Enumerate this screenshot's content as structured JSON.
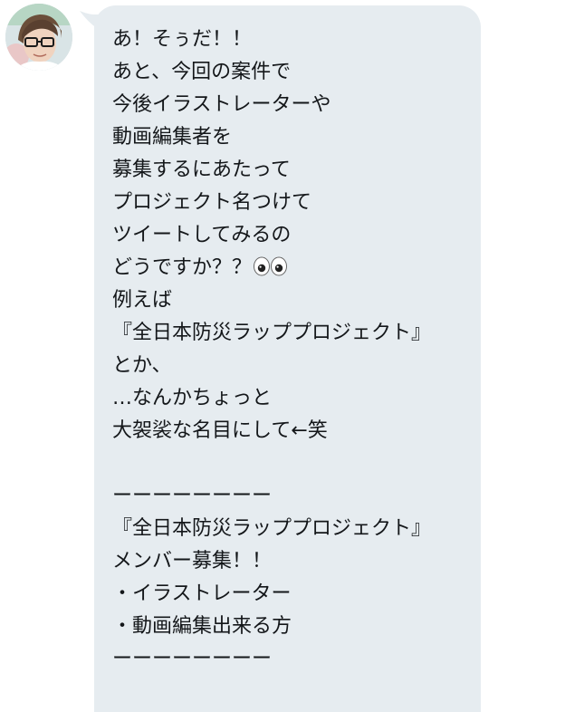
{
  "conversation": {
    "message": {
      "lines": [
        "あ！そぅだ！！",
        "あと、今回の案件で",
        "今後イラストレーターや",
        "動画編集者を",
        "募集するにあたって",
        "プロジェクト名つけて",
        "ツイートしてみるの",
        "どうですか？？",
        "例えば",
        "『全日本防災ラッププロジェクト』",
        "とか、",
        "…なんかちょっと",
        "大袈裟な名目にして←笑",
        "",
        "ーーーーーーーー",
        "『全日本防災ラッププロジェクト』",
        "メンバー募集！！",
        "・イラストレーター",
        "・動画編集出来る方",
        "ーーーーーーーー"
      ],
      "emoji_after_line_8": "eyes-icon"
    }
  },
  "colors": {
    "bubble_background": "#e6ecf0",
    "text": "#14171a"
  }
}
